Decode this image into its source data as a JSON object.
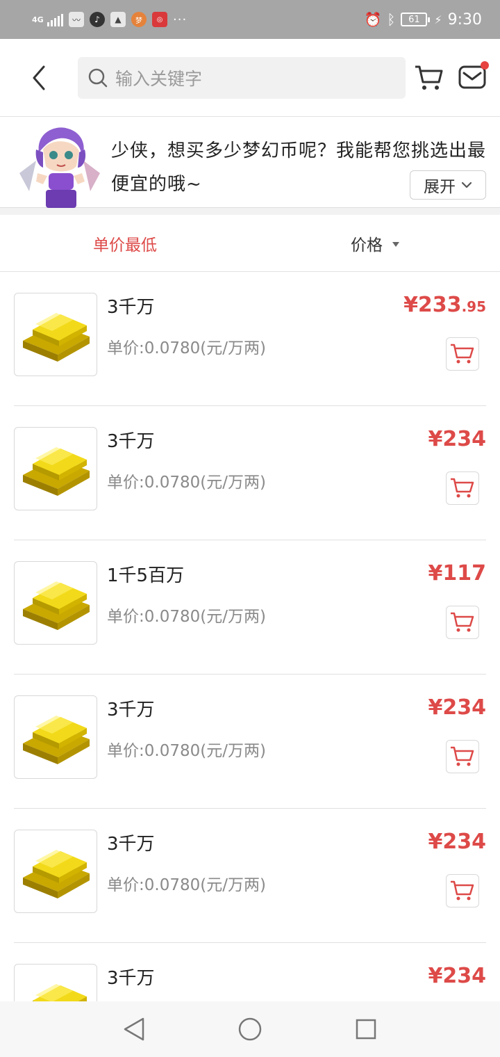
{
  "status_bar": {
    "network": "4G",
    "battery": "61",
    "time": "9:30",
    "app_badge_1": "梦",
    "app_badge_2": "◎"
  },
  "header": {
    "search_placeholder": "输入关键字",
    "back_icon": "chevron-left-icon",
    "cart_icon": "cart-icon",
    "mail_icon": "mail-icon",
    "accent": "#e64340"
  },
  "banner": {
    "text": "少侠，想买多少梦幻币呢？我能帮您挑选出最便宜的哦~",
    "expand_label": "展开"
  },
  "sort": {
    "lowest_unit_price": "单价最低",
    "price": "价格",
    "active_color": "#dd4a48"
  },
  "products": [
    {
      "name": "3千万",
      "unit_price": "单价:0.0780(元/万两)",
      "price_main": "¥233",
      "price_decimal": ".95"
    },
    {
      "name": "3千万",
      "unit_price": "单价:0.0780(元/万两)",
      "price_main": "¥234",
      "price_decimal": ""
    },
    {
      "name": "1千5百万",
      "unit_price": "单价:0.0780(元/万两)",
      "price_main": "¥117",
      "price_decimal": ""
    },
    {
      "name": "3千万",
      "unit_price": "单价:0.0780(元/万两)",
      "price_main": "¥234",
      "price_decimal": ""
    },
    {
      "name": "3千万",
      "unit_price": "单价:0.0780(元/万两)",
      "price_main": "¥234",
      "price_decimal": ""
    },
    {
      "name": "3千万",
      "unit_price": "",
      "price_main": "¥234",
      "price_decimal": ""
    }
  ]
}
